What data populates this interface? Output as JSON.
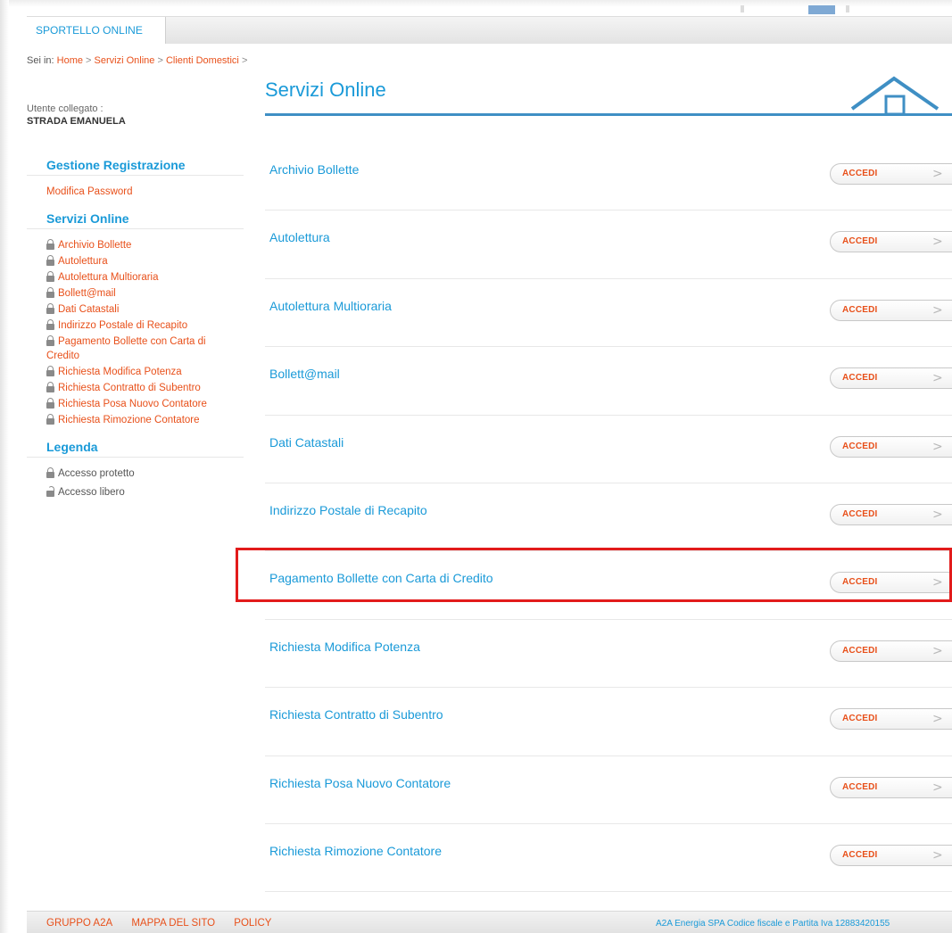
{
  "top_bar": {
    "tab_label": "SPORTELLO ONLINE"
  },
  "breadcrumb": {
    "prefix": "Sei in:",
    "items": [
      "Home",
      "Servizi Online",
      "Clienti Domestici"
    ],
    "separator": ">"
  },
  "user": {
    "label": "Utente collegato :",
    "name": "STRADA EMANUELA"
  },
  "sidebar": {
    "registration": {
      "heading": "Gestione Registrazione",
      "link": "Modifica Password"
    },
    "services": {
      "heading": "Servizi Online",
      "items": [
        "Archivio Bollette",
        "Autolettura",
        "Autolettura Multioraria",
        "Bollett@mail",
        "Dati Catastali",
        "Indirizzo Postale di Recapito",
        "Pagamento Bollette con Carta di Credito",
        "Richiesta Modifica Potenza",
        "Richiesta Contratto di Subentro",
        "Richiesta Posa Nuovo Contatore",
        "Richiesta Rimozione Contatore"
      ]
    },
    "legend": {
      "heading": "Legenda",
      "protected": "Accesso protetto",
      "free": "Accesso libero"
    }
  },
  "main": {
    "title": "Servizi Online",
    "button_label": "ACCEDI",
    "services": [
      "Archivio Bollette",
      "Autolettura",
      "Autolettura Multioraria",
      "Bollett@mail",
      "Dati Catastali",
      "Indirizzo Postale di Recapito",
      "Pagamento Bollette con Carta di Credito",
      "Richiesta Modifica Potenza",
      "Richiesta Contratto di Subentro",
      "Richiesta Posa Nuovo Contatore",
      "Richiesta Rimozione Contatore"
    ],
    "highlighted_service": "Pagamento Bollette con Carta di Credito"
  },
  "footer": {
    "links": [
      "GRUPPO A2A",
      "MAPPA DEL SITO",
      "POLICY"
    ],
    "copyright": "A2A Energia SPA Codice fiscale e Partita Iva 12883420155"
  },
  "colors": {
    "accent_blue": "#1a9ad8",
    "link_orange": "#e8501a",
    "highlight_red": "#e21b1b"
  },
  "icons": {
    "lock": "lock-icon",
    "unlock": "unlock-icon",
    "chevron": "chevron-right-icon",
    "house": "house-icon"
  }
}
